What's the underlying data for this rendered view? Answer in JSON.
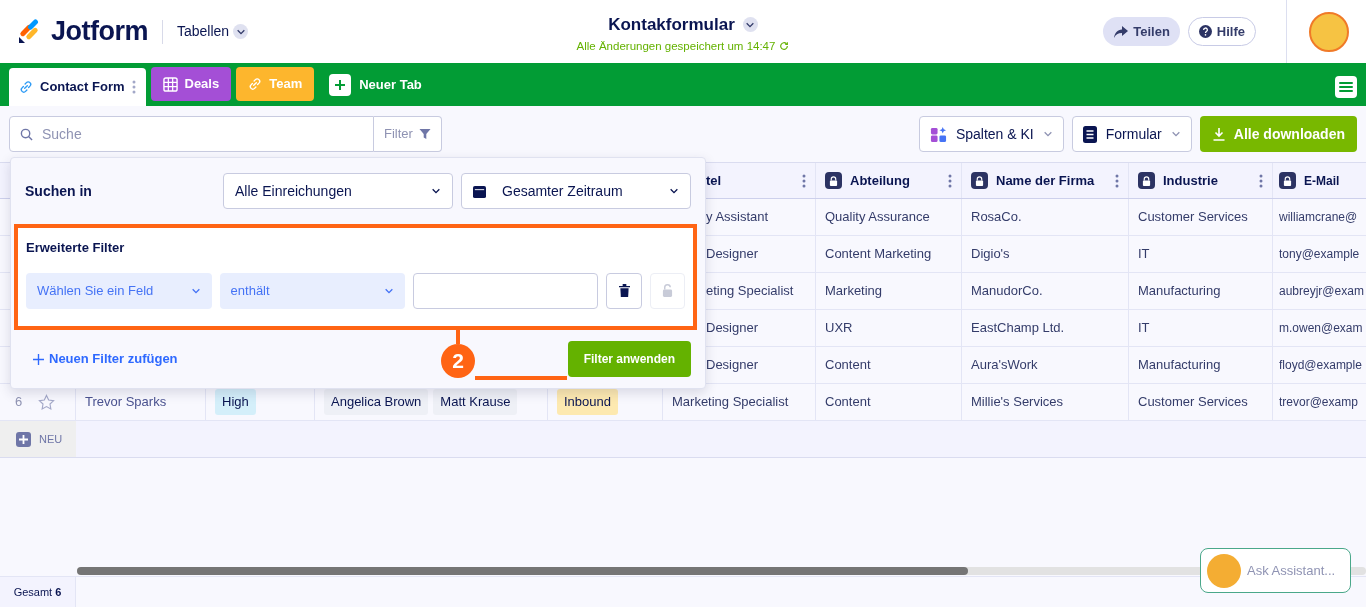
{
  "header": {
    "logo_text": "Jotform",
    "section": "Tabellen",
    "title": "Kontakformular",
    "save_status": "Alle Änderungen gespeichert um 14:47",
    "share_button": "Teilen",
    "help_button": "Hilfe"
  },
  "tabs": [
    {
      "label": "Contact Form",
      "kind": "link",
      "color": "#ffffff",
      "selected": true
    },
    {
      "label": "Deals",
      "kind": "grid",
      "color": "#a44fd6",
      "selected": false
    },
    {
      "label": "Team",
      "kind": "link",
      "color": "#fdb62d",
      "selected": false
    }
  ],
  "new_tab": "Neuer Tab",
  "toolbar": {
    "search": {
      "placeholder": "Suche"
    },
    "filter_button": "Filter",
    "columns_button": "Spalten & KI",
    "form_button": "Formular",
    "download_button": "Alle downloaden"
  },
  "filter_popup": {
    "search_in_label": "Suchen in",
    "scope_select": "Alle Einreichungen",
    "date_select": "Gesamter Zeitraum",
    "advanced_title": "Erweiterte Filter",
    "field_select": "Wählen Sie ein Feld",
    "operator_select": "enthält",
    "lock_button": {
      "disabled": true
    },
    "add_filter_link": "Neuen Filter zufügen",
    "apply_button": "Filter anwenden",
    "step_marker": "2"
  },
  "table": {
    "columns": [
      {
        "label": "tel",
        "locked": false
      },
      {
        "label": "Abteilung",
        "locked": true
      },
      {
        "label": "Name der Firma",
        "locked": true
      },
      {
        "label": "Industrie",
        "locked": true
      },
      {
        "label": "E-Mail",
        "locked": true
      }
    ],
    "rows": [
      {
        "title": "y Assistant",
        "department": "Quality Assurance",
        "company": "RosaCo.",
        "industry": "Customer Services",
        "email": "williamcrane@"
      },
      {
        "title": "Designer",
        "department": "Content Marketing",
        "company": "Digio's",
        "industry": "IT",
        "email": "tony@example"
      },
      {
        "title": "eting Specialist",
        "department": "Marketing",
        "company": "ManudorCo.",
        "industry": "Manufacturing",
        "email": "aubreyjr@exam"
      },
      {
        "title": "Designer",
        "department": "UXR",
        "company": "EastChamp Ltd.",
        "industry": "IT",
        "email": "m.owen@exam"
      },
      {
        "title": "Designer",
        "department": "Content",
        "company": "Aura'sWork",
        "industry": "Manufacturing",
        "email": "floyd@example"
      },
      {
        "number": "6",
        "starred": false,
        "name": "Trevor Sparks",
        "priority": {
          "label": "High",
          "color": "#d4effa"
        },
        "people": [
          "Angelica Brown",
          "Matt Krause"
        ],
        "source": {
          "label": "Inbound",
          "color": "#fde9b0"
        },
        "title": "Marketing Specialist",
        "department": "Content",
        "company": "Millie's Services",
        "industry": "Customer Services",
        "email": "trevor@examp"
      }
    ],
    "new_row": "NEU"
  },
  "footer": {
    "total": "Gesamt **6**"
  },
  "assistant": {
    "label": "Ask Assistant..."
  }
}
